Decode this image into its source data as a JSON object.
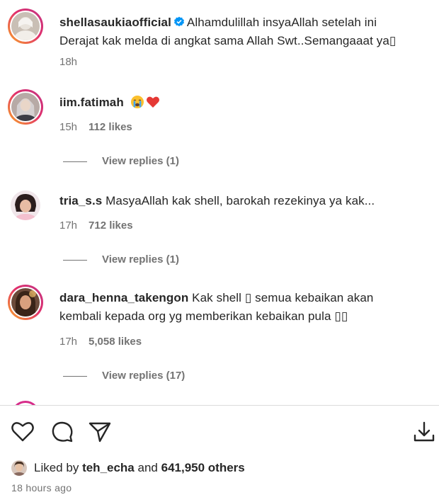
{
  "comments": [
    {
      "username": "shellasaukiaofficial",
      "verified": true,
      "text_line1": "Alhamdulillah insyaAllah setelah ini",
      "text_line2": "Derajat kak melda di angkat sama Allah Swt..Semangaaat ya▯",
      "time": "18h",
      "likes": ""
    },
    {
      "username": "iim.fatimah",
      "text": "",
      "emojis": [
        "crying-face-icon",
        "red-heart-icon"
      ],
      "time": "15h",
      "likes": "112 likes",
      "view_replies": "View replies (1)"
    },
    {
      "username": "tria_s.s",
      "text": "MasyaAllah kak shell, barokah rezekinya ya kak...",
      "time": "17h",
      "likes": "712 likes",
      "view_replies": "View replies (1)"
    },
    {
      "username": "dara_henna_takengon",
      "text_line1": "Kak shell ▯ semua kebaikan akan",
      "text_line2": "kembali kepada org yg memberikan kebaikan pula ▯▯",
      "time": "17h",
      "likes": "5,058 likes",
      "view_replies": "View replies (17)"
    }
  ],
  "footer": {
    "liked_by_prefix": "Liked by",
    "liked_by_user": "teh_echa",
    "liked_by_mid": "and",
    "liked_by_count": "641,950 others",
    "timestamp": "18 hours ago"
  },
  "colors": {
    "text": "#262626",
    "secondary": "#737373",
    "verified": "#0095f6",
    "heart": "#ed4956",
    "story_ring_start": "#f9a825",
    "story_ring_end": "#c13584"
  }
}
